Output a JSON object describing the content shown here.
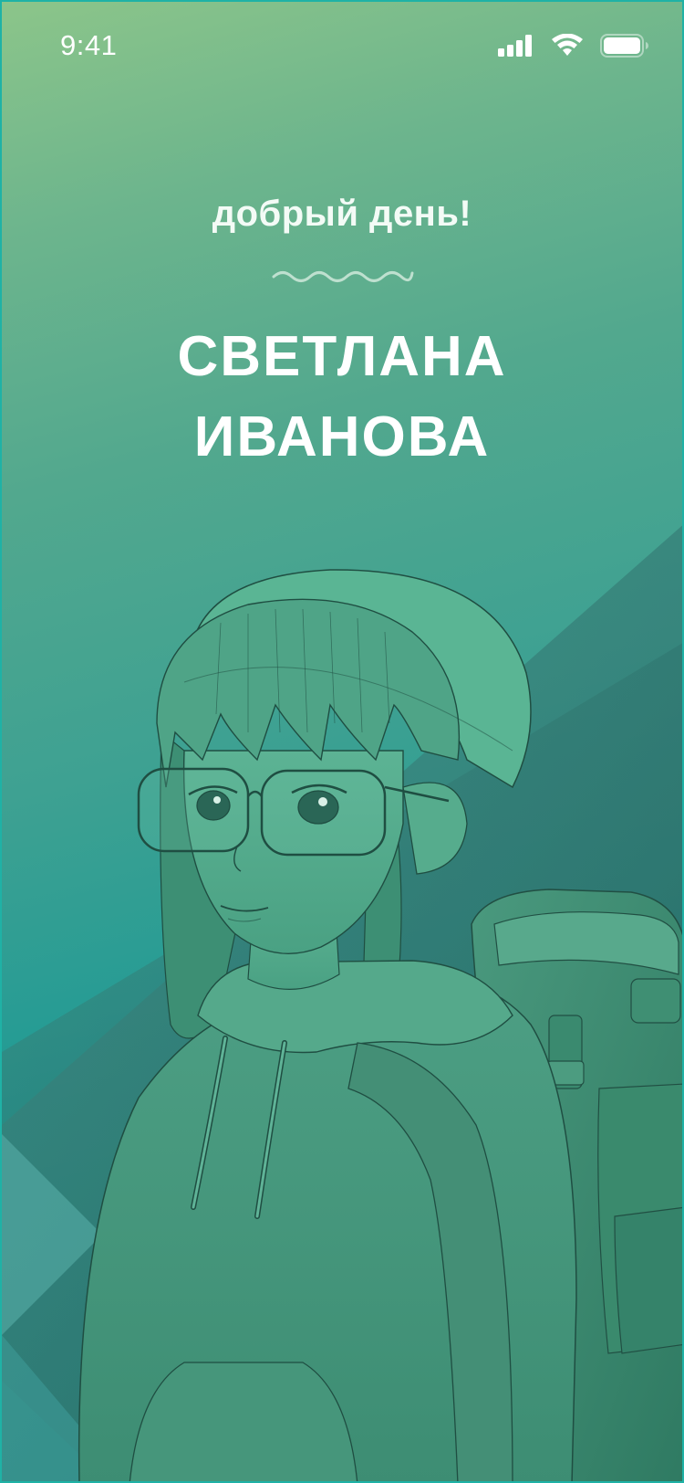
{
  "status_bar": {
    "time": "9:41",
    "icons": [
      "cellular-signal-icon",
      "wifi-icon",
      "battery-icon"
    ]
  },
  "greeting": {
    "text": "добрый день!",
    "user_name_line1": "СВЕТЛАНА",
    "user_name_line2": "ИВАНОВА"
  },
  "illustration": {
    "subject": "girl-with-glasses-hat-hoodie-backpack-illustration"
  },
  "colors": {
    "gradient_top": "#8cc58a",
    "gradient_mid": "#3ea192",
    "gradient_bottom": "#0f8c8a",
    "text": "#ffffff",
    "border": "#1fb2a6"
  }
}
